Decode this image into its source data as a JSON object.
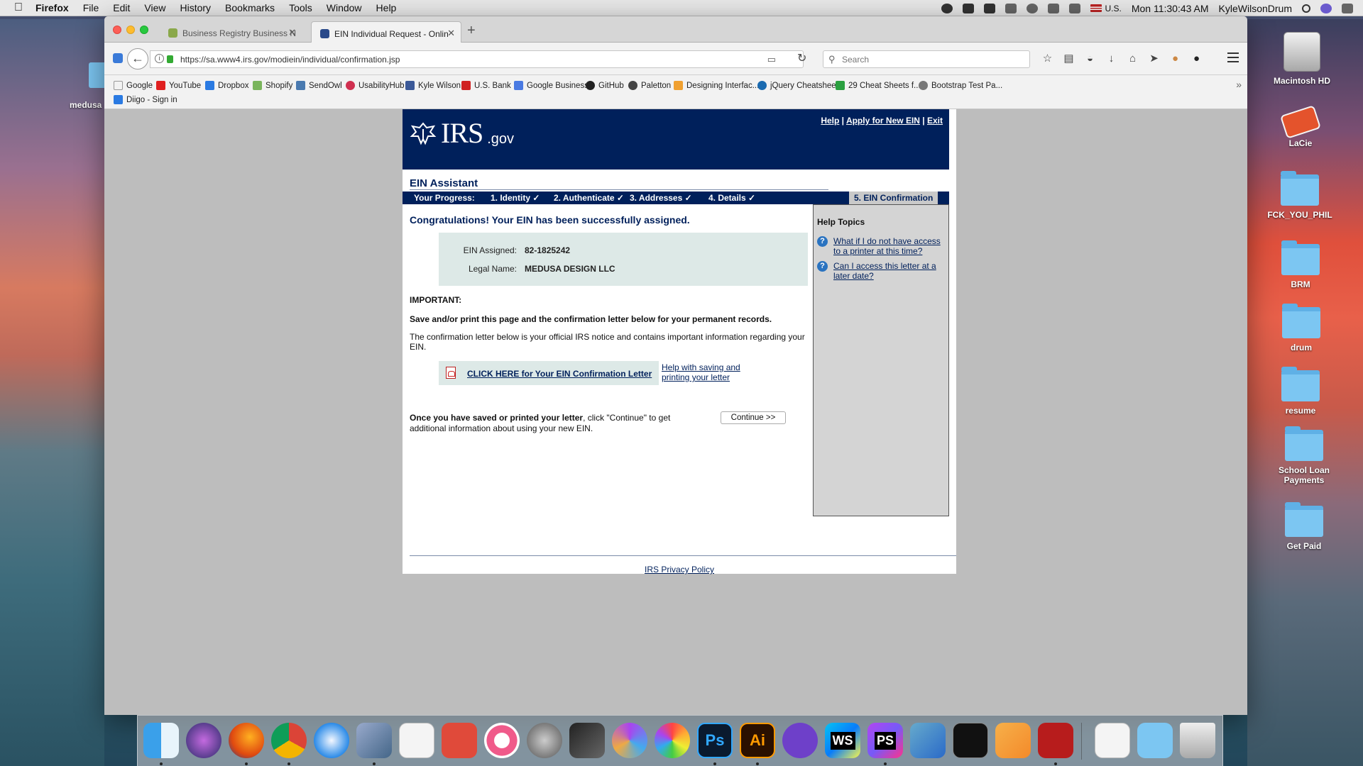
{
  "menubar": {
    "app_name": "Firefox",
    "menus": [
      "File",
      "Edit",
      "View",
      "History",
      "Bookmarks",
      "Tools",
      "Window",
      "Help"
    ],
    "input_source": "U.S.",
    "clock": "Mon 11:30:43 AM",
    "user": "KyleWilsonDrum"
  },
  "browser": {
    "tabs": [
      {
        "title": "Business Registry Business N",
        "active": false
      },
      {
        "title": "EIN Individual Request - Onlin",
        "active": true
      }
    ],
    "url": "https://sa.www4.irs.gov/modiein/individual/confirmation.jsp",
    "search_placeholder": "Search",
    "bookmarks": [
      {
        "label": "Google",
        "color": "#ffffff"
      },
      {
        "label": "YouTube",
        "color": "#e02020"
      },
      {
        "label": "Dropbox",
        "color": "#2a7ae2"
      },
      {
        "label": "Shopify",
        "color": "#7ab55c"
      },
      {
        "label": "SendOwl",
        "color": "#4a7ab0"
      },
      {
        "label": "UsabilityHub",
        "color": "#d03050"
      },
      {
        "label": "Kyle Wilson",
        "color": "#3b5998"
      },
      {
        "label": "U.S. Bank",
        "color": "#d02020"
      },
      {
        "label": "Google Business",
        "color": "#4a7ae2"
      },
      {
        "label": "GitHub",
        "color": "#222222"
      },
      {
        "label": "Paletton",
        "color": "#444444"
      },
      {
        "label": "Designing Interfac...",
        "color": "#f0a030"
      },
      {
        "label": "jQuery Cheatsheet",
        "color": "#1a6ab0"
      },
      {
        "label": "29  Cheat Sheets f...",
        "color": "#2aa040"
      },
      {
        "label": "Bootstrap Test Pa...",
        "color": "#777777"
      }
    ],
    "bookmarks_row2": [
      {
        "label": "Diigo - Sign in",
        "color": "#2a7ae2"
      }
    ]
  },
  "irs": {
    "logo_main": "IRS",
    "logo_suffix": ".gov",
    "top_links": [
      "Help",
      "Apply for New EIN",
      "Exit"
    ],
    "assistant_title": "EIN Assistant",
    "progress_label": "Your Progress:",
    "steps": [
      "1. Identity ✓",
      "2. Authenticate ✓",
      "3. Addresses ✓",
      "4. Details ✓",
      "5. EIN Confirmation"
    ],
    "congrats": "Congratulations! Your EIN has been successfully assigned.",
    "ein_label": "EIN Assigned:",
    "ein_value": "82-1825242",
    "legal_name_label": "Legal Name:",
    "legal_name_value": "MEDUSA DESIGN LLC",
    "important": "IMPORTANT:",
    "save_note": "Save and/or print this page and the confirmation letter below for your permanent records.",
    "confirmation_note": "The confirmation letter below is your official IRS notice and contains important information regarding your EIN.",
    "letter_link": "CLICK HERE for Your EIN Confirmation Letter",
    "help_saving": "Help with saving and printing your letter",
    "once_bold": "Once you have saved or printed your letter",
    "once_rest": ", click \"Continue\" to get additional information about using your new EIN.",
    "continue_button": "Continue >>",
    "help_topics_title": "Help Topics",
    "help_topics": [
      "What if I do not have access to a printer at this time?",
      "Can I access this letter at a later date?"
    ],
    "privacy": "IRS Privacy Policy"
  },
  "desktop": {
    "left_partial_label": "medusa",
    "icons": [
      "Macintosh HD",
      "LaCie",
      "FCK_YOU_PHIL",
      "BRM",
      "drum",
      "resume",
      "School Loan Payments",
      "Get Paid"
    ]
  },
  "dock": {
    "apps": [
      "Finder",
      "Siri",
      "Firefox",
      "Chrome",
      "Safari",
      "Preview",
      "TextEdit",
      "Bookmarks",
      "iTunes",
      "System Preferences",
      "Final Cut Pro",
      "Motion",
      "Photos",
      "Photoshop",
      "Illustrator",
      "GitHub Desktop",
      "WebStorm",
      "PhpStorm",
      "Xcode",
      "Terminal",
      "Pages",
      "Acrobat",
      "PDF",
      "Folder",
      "Trash"
    ],
    "labels": {
      "ps": "Ps",
      "ai": "Ai",
      "ws": "WS",
      "phps": "PS"
    }
  }
}
